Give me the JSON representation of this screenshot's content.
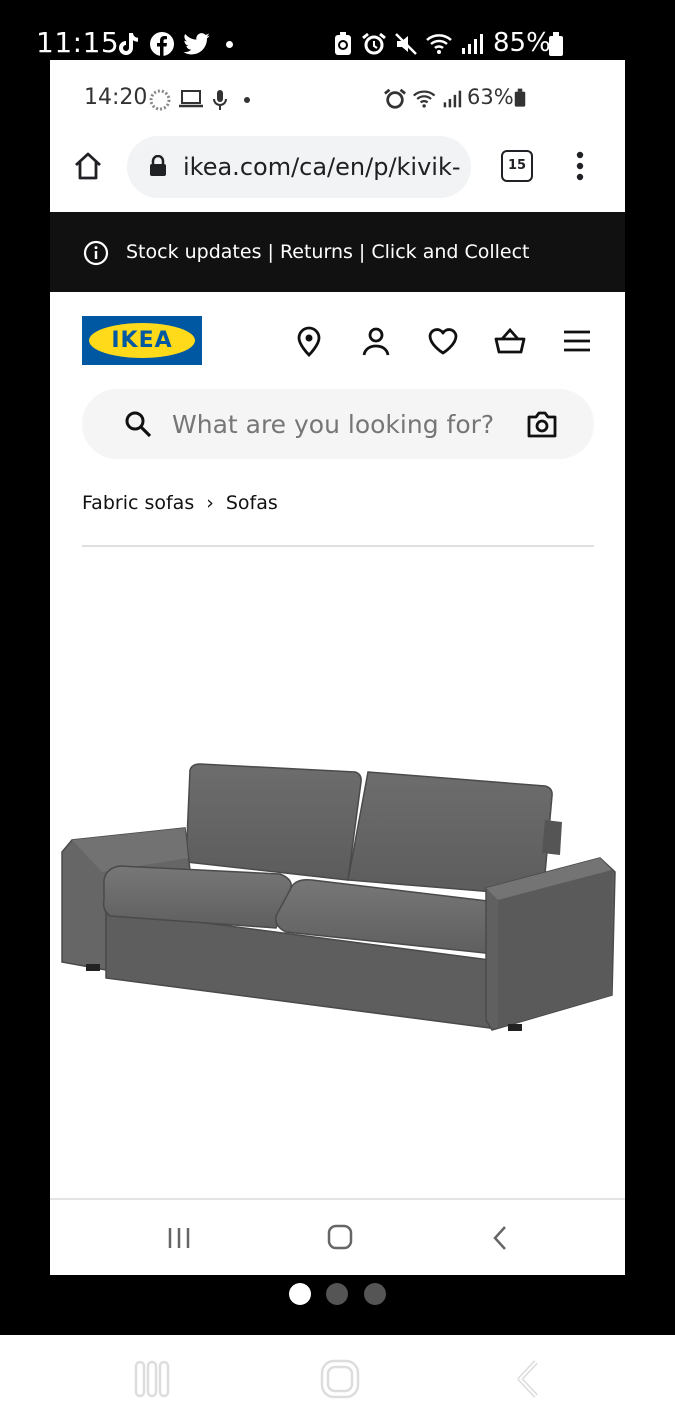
{
  "outer_status": {
    "time": "11:15",
    "battery": "85%"
  },
  "inner_status": {
    "time": "14:20",
    "battery": "63%"
  },
  "browser": {
    "url": "ikea.com/ca/en/p/kivik-",
    "tab_count": "15"
  },
  "banner": {
    "text": "Stock updates | Returns | Click and Collect"
  },
  "header": {
    "logo_text": "IKEA"
  },
  "search": {
    "placeholder": "What are you looking for?"
  },
  "breadcrumb": {
    "items": [
      "Fabric sofas",
      "Sofas"
    ],
    "separator": "›"
  },
  "product": {
    "image_icon": "gray-sofa-image"
  },
  "carousel": {
    "pages": 3,
    "active_page": 1
  },
  "colors": {
    "ikea_blue": "#0058a3",
    "ikea_yellow": "#ffda1a",
    "banner_bg": "#111111"
  }
}
